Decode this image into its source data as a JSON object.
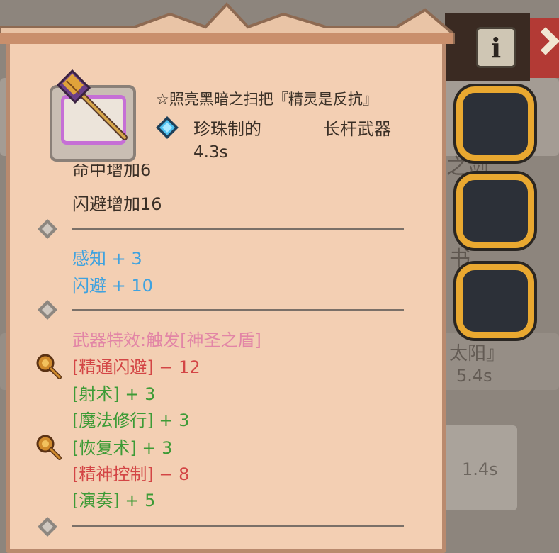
{
  "background": {
    "texts": [
      "之剑",
      "书",
      "太阳』",
      "5.4s",
      "1.4s"
    ]
  },
  "buttons": {
    "info_label": "i"
  },
  "item": {
    "name": "☆照亮黑暗之扫把『精灵是反抗』",
    "material": "珍珠制的",
    "weapon_type": "长杆武器",
    "speed": "4.3s",
    "rarity_color": "#c66fd6"
  },
  "stats": {
    "cut_line": "命中增加6",
    "evasion_line": "闪避增加16",
    "attrs": [
      {
        "text": "感知 + 3",
        "color": "#3fa2df"
      },
      {
        "text": "闪避 + 10",
        "color": "#3fa2df"
      }
    ],
    "effect": {
      "text": "武器特效:触发[神圣之盾]",
      "color": "#e285a6"
    },
    "skills": [
      {
        "text": "[精通闪避] − 12",
        "color": "#d34545",
        "icon": "scroll-icon"
      },
      {
        "text": "[射术] + 3",
        "color": "#3d9b36"
      },
      {
        "text": "[魔法修行] + 3",
        "color": "#3d9b36"
      },
      {
        "text": "[恢复术] + 3",
        "color": "#3d9b36",
        "icon": "scroll-icon"
      },
      {
        "text": "[精神控制] − 8",
        "color": "#d34545"
      },
      {
        "text": "[演奏] + 5",
        "color": "#3d9b36"
      }
    ]
  },
  "slots": [
    "empty",
    "empty",
    "empty"
  ]
}
